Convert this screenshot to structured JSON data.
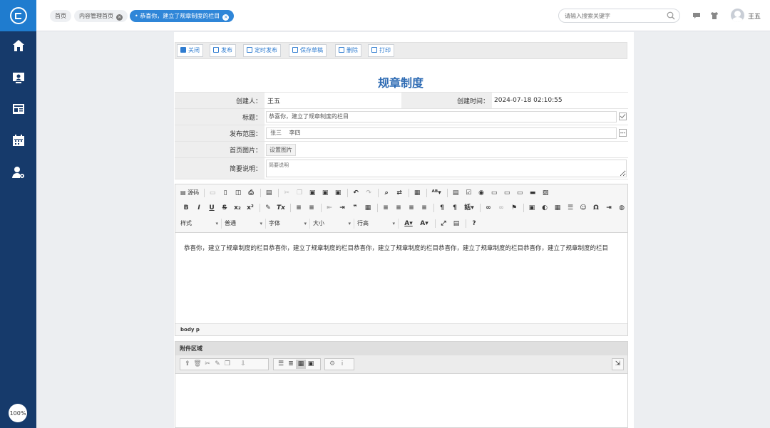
{
  "app": {
    "zoom_label": "100%"
  },
  "tabs": [
    {
      "label": "首页",
      "closable": false,
      "active": false
    },
    {
      "label": "内容管理首页",
      "closable": true,
      "active": false
    },
    {
      "label": "• 恭喜你，建立了规章制度的栏目",
      "closable": true,
      "active": true
    }
  ],
  "search": {
    "placeholder": "请输入搜索关键字"
  },
  "user": {
    "name": "王五"
  },
  "toolbar": {
    "close": "关闭",
    "publish": "发布",
    "schedule": "定时发布",
    "save_draft": "保存草稿",
    "delete": "删除",
    "print": "打印"
  },
  "doc_title": "规章制度",
  "form": {
    "creator_label": "创建人：",
    "creator": "王五",
    "created_label": "创建时间：",
    "created_at": "2024-07-18 02:10:55",
    "title_label": "标题：",
    "title_value": "恭喜你，建立了规章制度的栏目",
    "scope_label": "发布范围：",
    "scope_value": "张三　 李四",
    "image_label": "首页图片：",
    "image_button": "设置图片",
    "desc_label": "简要说明：",
    "desc_placeholder": "简要说明"
  },
  "editor": {
    "source_label": "源码",
    "style_combo": "样式",
    "format_combo": "普通",
    "font_combo": "字体",
    "size_combo": "大小",
    "lineheight_combo": "行高",
    "body_text": "恭喜你，建立了规章制度的栏目恭喜你，建立了规章制度的栏目恭喜你，建立了规章制度的栏目恭喜你，建立了规章制度的栏目恭喜你，建立了规章制度的栏目",
    "path": "body  p"
  },
  "attachment": {
    "header": "附件区域"
  },
  "colors": {
    "sidebar": "#163a6b",
    "logo": "#1f7ccf",
    "accent": "#2f86d8",
    "title": "#2f6cb4"
  }
}
